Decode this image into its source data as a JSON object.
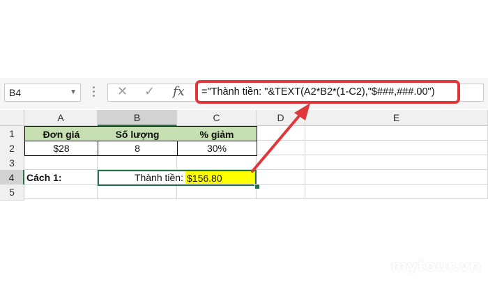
{
  "formula_bar": {
    "name_box": "B4",
    "formula": "=\"Thành tiền: \"&TEXT(A2*B2*(1-C2),\"$###,###.00\")"
  },
  "columns": [
    "A",
    "B",
    "C",
    "D",
    "E"
  ],
  "rows": [
    "1",
    "2",
    "3",
    "4",
    "5"
  ],
  "cells": {
    "A1": "Đơn giá",
    "B1": "Số lượng",
    "C1": "% giảm",
    "A2": "$28",
    "B2": "8",
    "C2": "30%",
    "A4": "Cách 1:",
    "B4": "Thành tiền:",
    "C4": "$156.80"
  },
  "colors": {
    "header_fill": "#c6e0b4",
    "highlight": "#ffff00",
    "annotation": "#e0373a",
    "selection": "#217346"
  },
  "watermark": "mytour.vn"
}
